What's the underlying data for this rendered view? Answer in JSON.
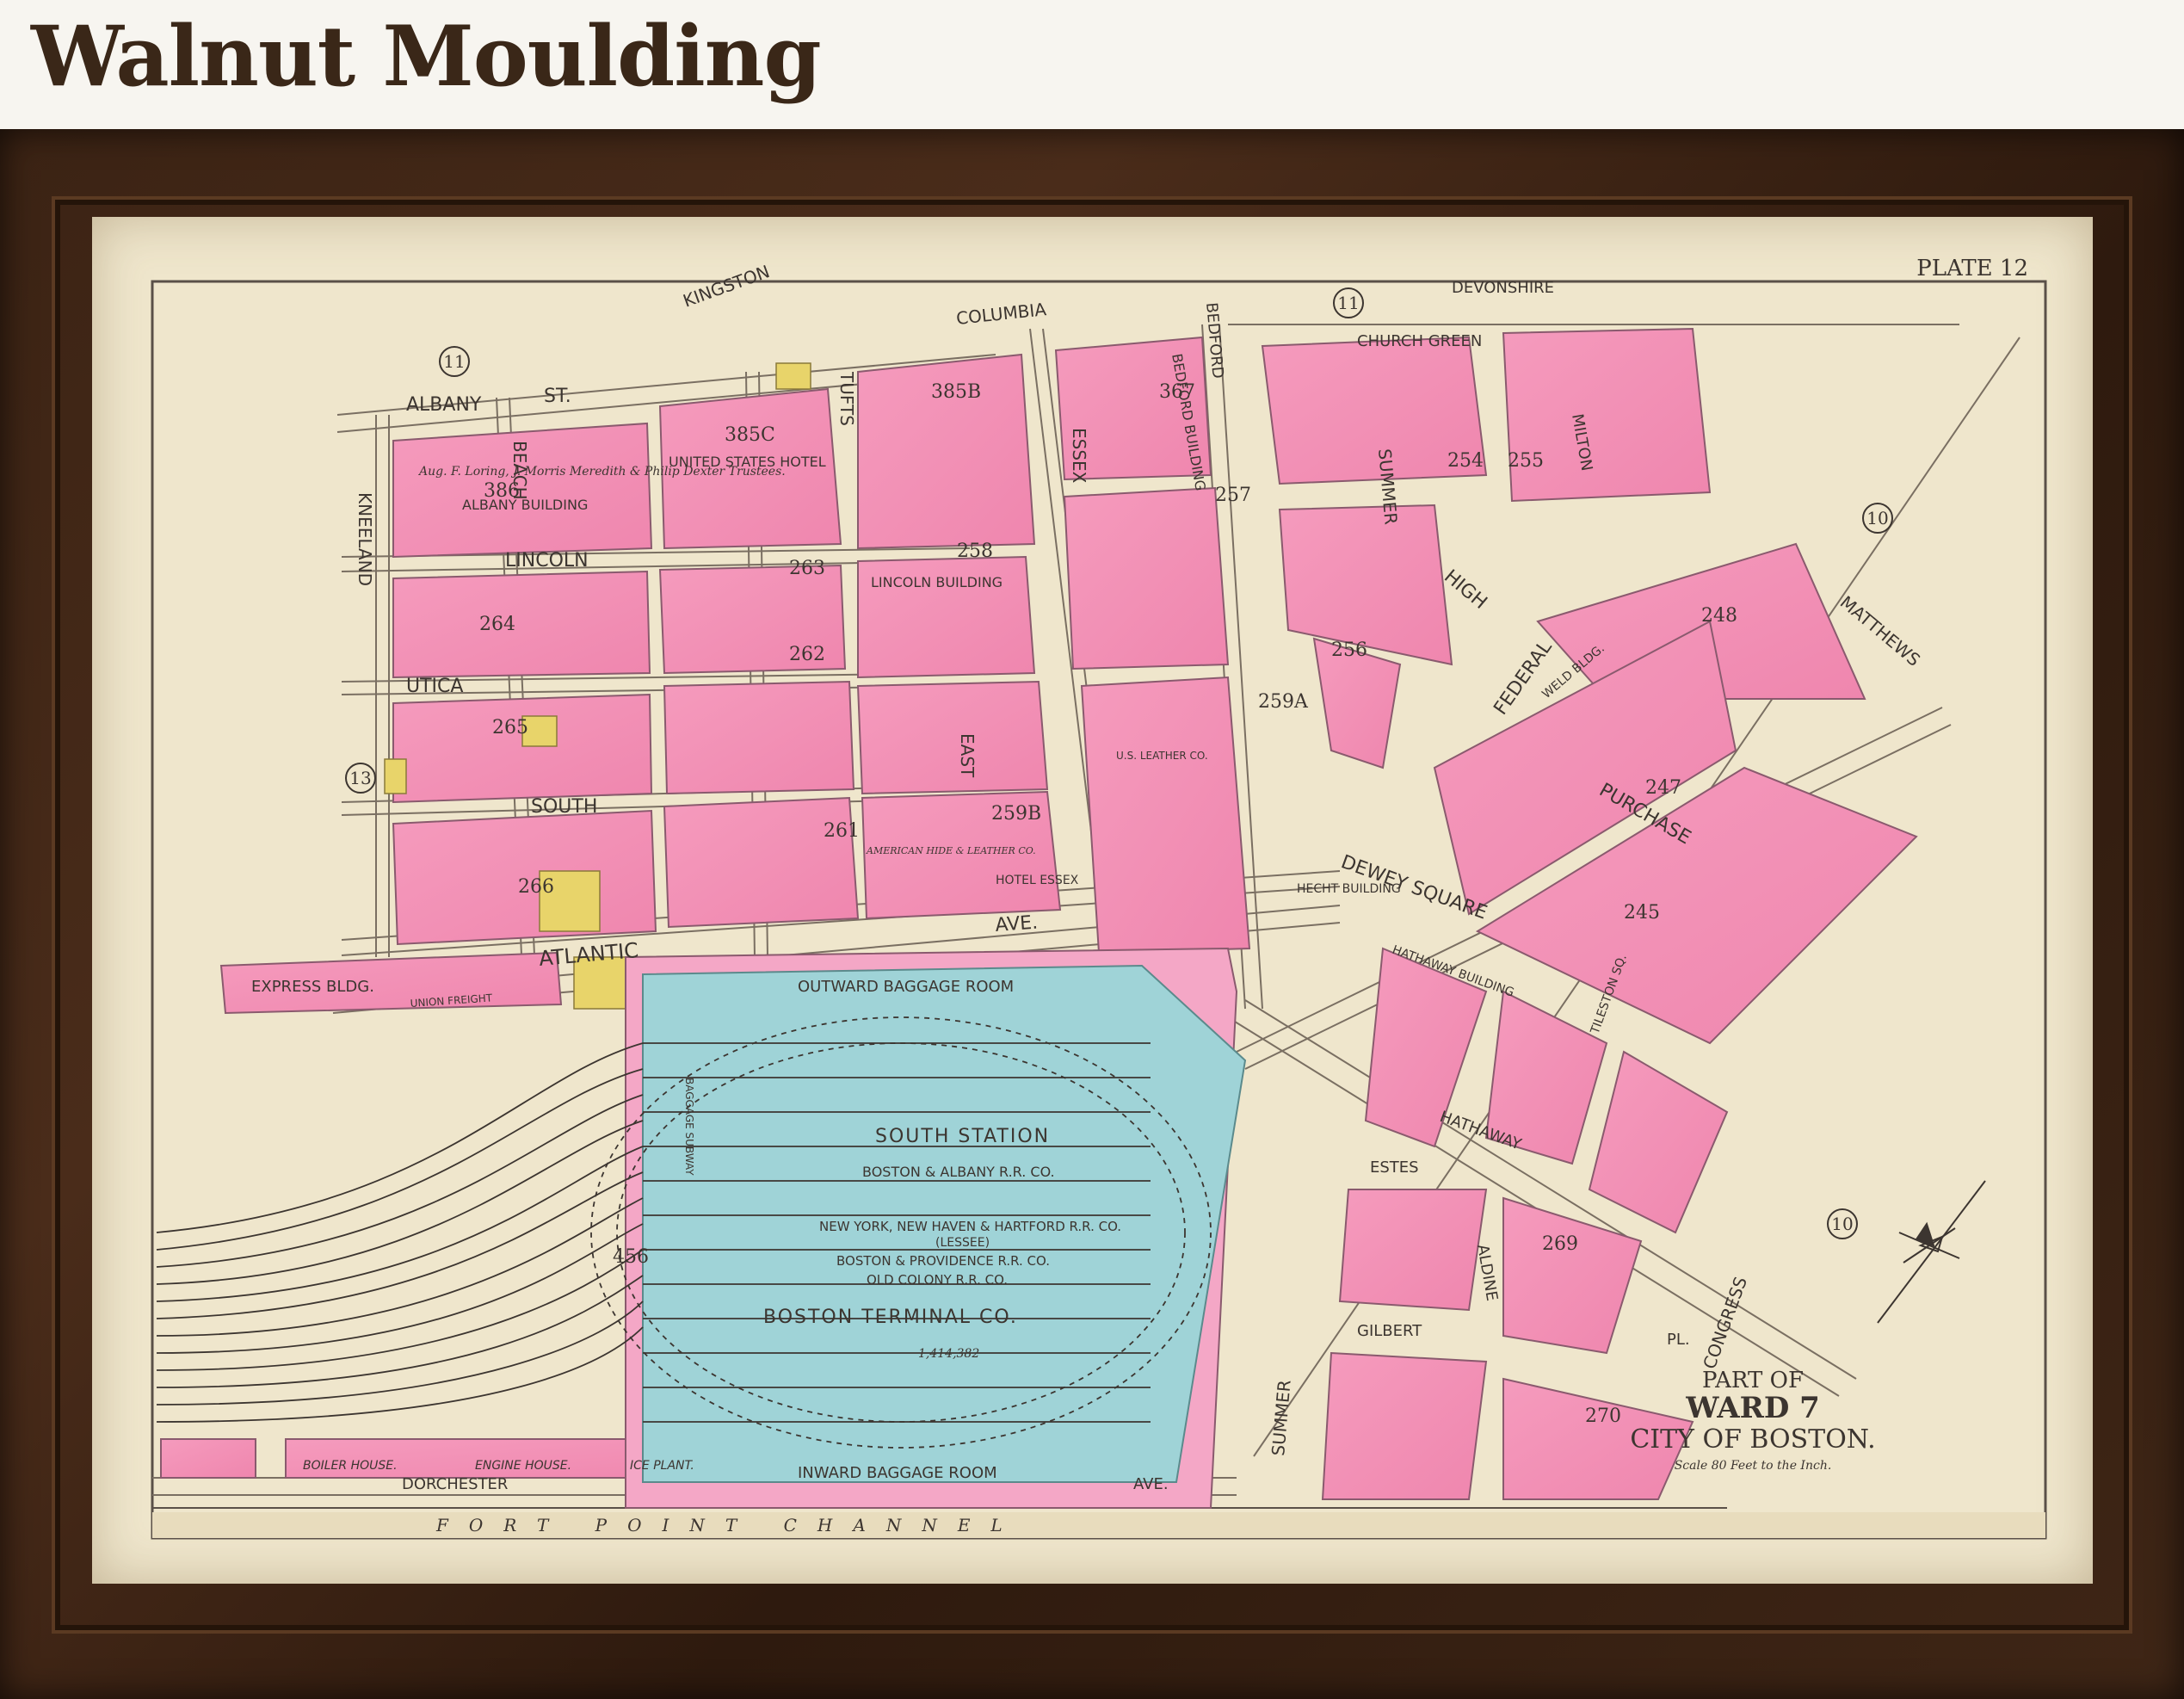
{
  "header": {
    "title": "Walnut Moulding"
  },
  "map": {
    "plate": "PLATE 12",
    "title_lines": [
      "PART OF",
      "WARD 7",
      "CITY OF BOSTON."
    ],
    "scale": "Scale 80 Feet to the Inch.",
    "ward_markers": [
      "11",
      "11",
      "10",
      "13",
      "10"
    ],
    "streets": {
      "albany": "ALBANY",
      "st": "ST.",
      "kneeland": "KNEELAND",
      "beach": "BEACH",
      "lincoln": "LINCOLN",
      "utica": "UTICA",
      "south": "SOUTH",
      "kingston": "KINGSTON",
      "essex": "ESSEX",
      "columbia": "COLUMBIA",
      "bedford": "BEDFORD",
      "church_green": "CHURCH GREEN",
      "summer": "SUMMER",
      "devonshire": "DEVONSHIRE",
      "milton": "MILTON",
      "high": "HIGH",
      "federal": "FEDERAL",
      "purchase": "PURCHASE",
      "atlantic": "ATLANTIC",
      "ave": "AVE.",
      "dewey_square": "DEWEY SQUARE",
      "matthews": "MATTHEWS",
      "east": "EAST",
      "tufts": "TUFTS",
      "hathaway": "HATHAWAY",
      "estes": "ESTES",
      "gilbert": "GILBERT",
      "aldine": "ALDINE",
      "pl": "PL.",
      "congress": "CONGRESS",
      "dorchester": "DORCHESTER",
      "fort_point_channel": "FORT POINT CHANNEL",
      "union_freight": "UNION FREIGHT",
      "tileston_sq": "TILESTON SQ."
    },
    "buildings": {
      "albany_building": "ALBANY BUILDING",
      "united_states_hotel": "UNITED STATES HOTEL",
      "lincoln_building": "LINCOLN BUILDING",
      "bedford_building": "BEDFORD BUILDING",
      "express_bldg": "EXPRESS BLDG.",
      "outward_baggage_room": "OUTWARD BAGGAGE ROOM",
      "inward_baggage_room": "INWARD BAGGAGE ROOM",
      "south_station": "SOUTH STATION",
      "boston_albany": "BOSTON & ALBANY R.R. CO.",
      "ny_nh_h": "NEW YORK, NEW HAVEN & HARTFORD R.R. CO.",
      "lessee": "(LESSEE)",
      "boston_providence": "BOSTON & PROVIDENCE R.R. CO.",
      "old_colony": "OLD COLONY R.R. CO.",
      "boston_terminal": "BOSTON TERMINAL CO.",
      "terminal_area": "1,414,382",
      "boiler_house": "BOILER HOUSE.",
      "engine_house": "ENGINE HOUSE.",
      "ice_plant": "ICE PLANT.",
      "hathaway_building": "HATHAWAY BUILDING",
      "weld_bldg": "WELD BLDG.",
      "hecht_building": "HECHT BUILDING",
      "hotel_essex": "HOTEL ESSEX",
      "baggage_subway": "BAGGAGE SUBWAY",
      "american_hide": "AMERICAN HIDE & LEATHER CO.",
      "us_leather": "U.S. LEATHER CO.",
      "albany_owners": "Aug. F. Loring, J. Morris Meredith & Philip Dexter Trustees."
    },
    "block_numbers": [
      "386",
      "385C",
      "385B",
      "367",
      "258",
      "257",
      "264",
      "263",
      "262",
      "265",
      "266",
      "261",
      "259B",
      "259A",
      "256",
      "254",
      "255",
      "248",
      "247",
      "245",
      "456",
      "269",
      "270"
    ]
  }
}
